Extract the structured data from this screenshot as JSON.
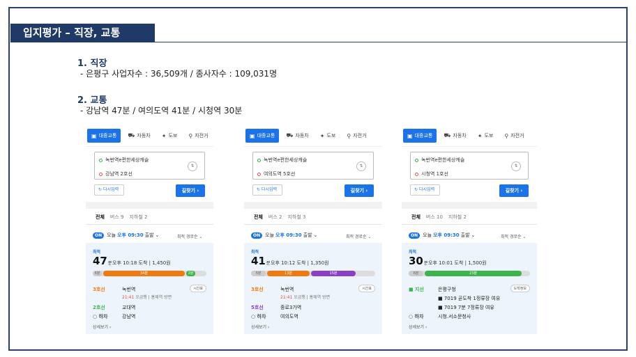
{
  "slide_title": "입지평가 – 직장, 교통",
  "section1": {
    "heading": "1. 직장",
    "text": "- 은평구 사업자수 : 36,509개  / 종사자수 : 109,031명"
  },
  "section2": {
    "heading": "2. 교통",
    "text": "- 강남역 47분 / 여의도역 41분 / 시청역 30분"
  },
  "colors": {
    "accent": "#1a73e8",
    "title_bg": "#1f3a66",
    "line3": "#f07a10",
    "line2": "#3cb44b",
    "line5": "#8a3fc7",
    "bus_green": "#3cb44b"
  },
  "tabs": {
    "transit": "대중교통",
    "car": "자동차",
    "walk": "도보",
    "bike": "자전거"
  },
  "icons": {
    "transit": "bus-icon",
    "car": "car-icon",
    "walk": "walk-icon",
    "bike": "bicycle-icon",
    "swap": "swap-icon",
    "reset": "refresh-icon"
  },
  "common": {
    "reset": "다시입력",
    "go": "길찾기 ›",
    "all": "전체",
    "on": "ON",
    "today": "오늘",
    "depart_time": "오후 09:30",
    "depart": "출발",
    "sort": "최적 경로순 ⌄",
    "optimal": "최적",
    "unit": "분",
    "alight": "○ 하차",
    "more": "상세보기 ›"
  },
  "cards": [
    {
      "from": "녹번역e편한세상캐슬",
      "to": "강남역 2호선",
      "bus": "버스 9",
      "subway": "지하철 2",
      "minutes": "47",
      "arrival": "오후 10:18 도착  |  1,450원",
      "bar": [
        {
          "kind": "walk",
          "label": "6분",
          "share": 0.08
        },
        {
          "kind": "line3",
          "label": "34분",
          "share": 0.72
        },
        {
          "kind": "line2",
          "label": "2분",
          "share": 0.08
        }
      ],
      "steps": [
        {
          "line": "3호선",
          "color": "#f07a10",
          "station": "녹번역",
          "sub_red": "21:41",
          "sub": " 오금행 | 홍제역 방면",
          "pill": "시간표"
        },
        {
          "line": "2호선",
          "color": "#3cb44b",
          "station": "교대역",
          "sub_red": "",
          "sub": "",
          "pill": ""
        },
        {
          "line": "○ 하차",
          "color": "#555555",
          "station": "강남역",
          "sub_red": "",
          "sub": "",
          "pill": ""
        }
      ],
      "more": "상세보기 ›"
    },
    {
      "from": "녹번역e편한세상캐슬",
      "to": "여의도역 5호선",
      "bus": "버스 2",
      "subway": "지하철 3",
      "minutes": "41",
      "arrival": "오후 10:12 도착  |  1,350원",
      "bar": [
        {
          "kind": "walk",
          "label": "5분",
          "share": 0.12
        },
        {
          "kind": "line3",
          "label": "13분",
          "share": 0.34
        },
        {
          "kind": "line5",
          "label": "15분",
          "share": 0.36
        }
      ],
      "steps": [
        {
          "line": "3호선",
          "color": "#f07a10",
          "station": "녹번역",
          "sub_red": "21:41",
          "sub": " 오금행 | 홍제역 방면",
          "pill": "시간표"
        },
        {
          "line": "5호선",
          "color": "#8a3fc7",
          "station": "종로3가역",
          "sub_red": "",
          "sub": "",
          "pill": ""
        },
        {
          "line": "○ 하차",
          "color": "#555555",
          "station": "여의도역",
          "sub_red": "",
          "sub": "",
          "pill": ""
        }
      ],
      "more": "상세보기 ›"
    },
    {
      "from": "녹번역e편한세상캐슬",
      "to": "시청역 1호선",
      "bus": "버스 10",
      "subway": "지하철 2",
      "minutes": "30",
      "arrival": "오후 10:01 도착  |  1,500원",
      "bar": [
        {
          "kind": "walk",
          "label": "6분",
          "share": 0.12
        },
        {
          "kind": "bus",
          "label": "23분",
          "share": 0.8
        }
      ],
      "steps": [
        {
          "line": "■ 지선",
          "color": "#3cb44b",
          "station": "은평구청",
          "sub_red": "",
          "sub": "",
          "pill": "도착정보"
        },
        {
          "line": "",
          "color": "#555555",
          "station": "■ 7019  곧도착  1정류장  여유",
          "sub_red": "",
          "sub": "",
          "pill": ""
        },
        {
          "line": "",
          "color": "#555555",
          "station": "■ 7019  7분  7정류장  여유",
          "sub_red": "",
          "sub": "",
          "pill": ""
        },
        {
          "line": "○ 하차",
          "color": "#555555",
          "station": "시청.서소문청사",
          "sub_red": "",
          "sub": "",
          "pill": ""
        }
      ],
      "more": "상세보기 ›"
    }
  ]
}
